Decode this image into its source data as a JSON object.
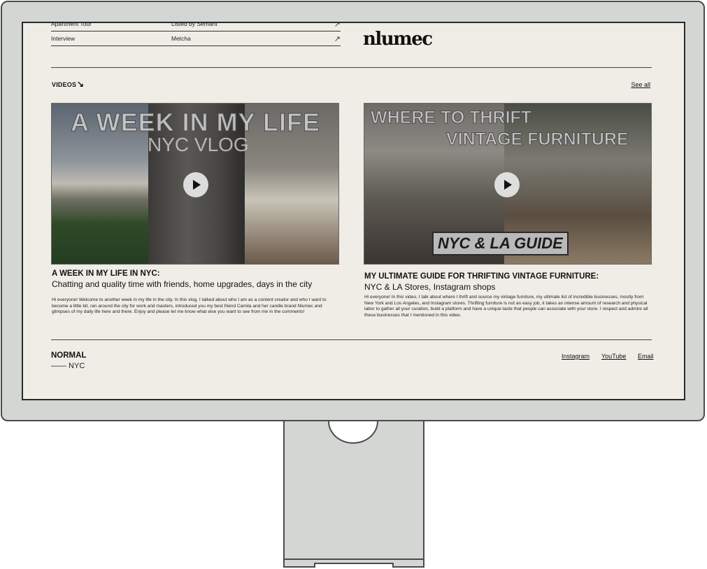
{
  "press": [
    {
      "type": "Apartment Tour",
      "outlet": "Listed by Semant"
    },
    {
      "type": "Interview",
      "outlet": "Metcha"
    }
  ],
  "brand": {
    "logo": "nlumec"
  },
  "videos": {
    "section_title": "VIDEOS",
    "see_all": "See all",
    "items": [
      {
        "overlay_title": "A WEEK IN MY LIFE",
        "overlay_sub": "NYC VLOG",
        "title": "A WEEK IN MY LIFE IN NYC:",
        "subtitle": "Chatting and quality time with friends, home upgrades, days in the city",
        "description": "Hi everyone! Welcome to another week in my life in the city. In this vlog, I talked about who I am as a content creator and who I want to become a little bit, ran around the city for work and masters, introduced you my best friend Camila and her candle brand Nlumec and glimpses of my daily life here and there. Enjoy and please let me know what else you want to see from me in the comments!"
      },
      {
        "overlay_title_1": "WHERE TO THRIFT",
        "overlay_title_2": "VINTAGE FURNITURE",
        "overlay_badge": "NYC & LA GUIDE",
        "title": "MY ULTIMATE GUIDE FOR THRIFTING VINTAGE FURNITURE:",
        "subtitle": "NYC & LA Stores, Instagram shops",
        "description": "Hi everyone! In this video, I talk about where I thrift and source my vintage furniture, my ultimate list of incredible businesses, mostly from New York and Los Angeles, and Instagram stores. Thrifting furniture is not an easy job, it takes an intense amount of research and physical labor to gather all your curation, build a platform and have a unique taste that people can associate with your store. I respect and admire all these businesses that I mentioned in this video."
      }
    ]
  },
  "footer": {
    "name": "NORMAL",
    "location": "—— NYC",
    "links": [
      "Instagram",
      "YouTube",
      "Email"
    ]
  },
  "colors": {
    "screen_bg": "#efede6",
    "bezel": "#d3d6d2",
    "text": "#111111"
  }
}
